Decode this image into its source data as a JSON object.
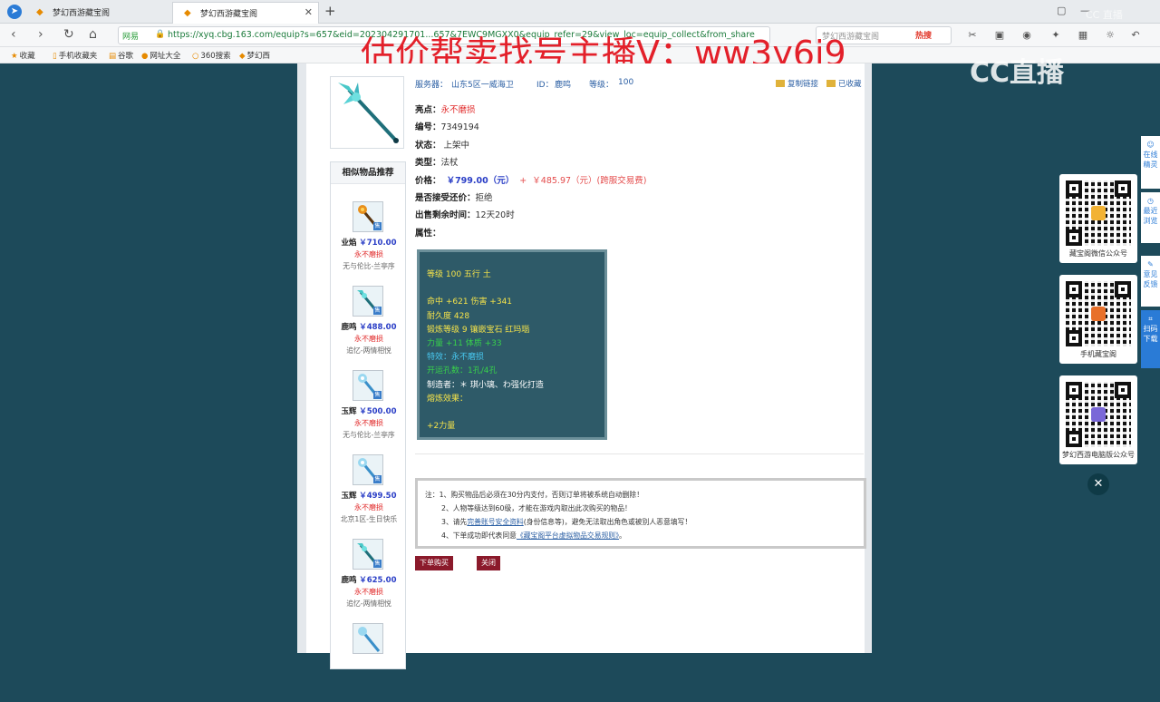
{
  "browser": {
    "tabs": [
      {
        "label": "梦幻西游藏宝阁"
      },
      {
        "label": "梦幻西游藏宝阁"
      }
    ],
    "url": "https://xyq.cbg.163.com/equip?s=657&eid=202304291701...657&7EWC9MGXX0&equip_refer=29&view_loc=equip_collect&from_share",
    "site_label": "网易",
    "search_placeholder": "梦幻西游藏宝阁",
    "hot_label": "热搜",
    "bookmarks": [
      "收藏",
      "手机收藏夹",
      "谷歌",
      "网址大全",
      "360搜索",
      "梦幻西"
    ]
  },
  "overlay": {
    "promo_text": "估价帮卖找号主播V；ww3y6j9",
    "logo_text": "CC直播"
  },
  "item": {
    "header": {
      "server_label": "服务器：",
      "server_value": "山东5区一威海卫",
      "id_label": "ID：",
      "id_value": "鹿鸣",
      "level_label": "等级：",
      "level_value": "100",
      "copy_link": "复制链接",
      "collected": "已收藏"
    },
    "highlight_label": "亮点：",
    "highlight_value": "永不磨损",
    "serial_label": "编号：",
    "serial_value": "7349194",
    "status_label": "状态：",
    "status_value": "上架中",
    "type_label": "类型：",
    "type_value": "法杖",
    "price_label": "价格：",
    "price_value": "￥799.00（元）",
    "price_plus": "+",
    "price_fee": "￥485.97（元）(跨服交易费)",
    "bargain_label": "是否接受还价：",
    "bargain_value": "拒绝",
    "time_label": "出售剩余时间：",
    "time_value": "12天20时",
    "props_label": "属性：",
    "stats": {
      "line1": "等级 100  五行 土",
      "line2": "命中 +621 伤害 +341",
      "line3": "耐久度 428",
      "line4": "锻炼等级 9  镶嵌宝石 红玛瑙",
      "line5": "力量 +11 体质 +33",
      "line6": "特效：永不磨损",
      "line7": "开运孔数：1孔/4孔",
      "line8": "制造者：＊ 琪小璃、わ强化打造",
      "line9": "熔炼效果：",
      "line10": "+2力量"
    }
  },
  "notes": {
    "line1": "注：1、购买物品后必须在30分内支付，否则订单将被系统自动删除！",
    "line2": "2、人物等级达到60级，才能在游戏内取出此次购买的物品！",
    "line3_pre": "3、请先",
    "line3_link": "完善账号安全资料",
    "line3_post": "(身份信息等)，避免无法取出角色或被别人恶意填写！",
    "line4_pre": "4、下单成功即代表同意",
    "line4_link": "《藏宝阁平台虚拟物品交易规则》",
    "line4_post": "。"
  },
  "buttons": {
    "buy": "下单购买",
    "close": "关闭"
  },
  "related": {
    "title": "相似物品推荐",
    "items": [
      {
        "name": "业焰",
        "price": "￥710.00",
        "tag": "永不磨损",
        "server": "无与伦比-兰亭序"
      },
      {
        "name": "鹿鸣",
        "price": "￥488.00",
        "tag": "永不磨损",
        "server": "追忆-两情相悦"
      },
      {
        "name": "玉辉",
        "price": "￥500.00",
        "tag": "永不磨损",
        "server": "无与伦比-兰亭序"
      },
      {
        "name": "玉辉",
        "price": "￥499.50",
        "tag": "永不磨损",
        "server": "北京1区-生日快乐"
      },
      {
        "name": "鹿鸣",
        "price": "￥625.00",
        "tag": "永不磨损",
        "server": "追忆-两情相悦"
      }
    ]
  },
  "side_qr": [
    {
      "label": "藏宝阁微信公众号"
    },
    {
      "label": "手机藏宝阁"
    },
    {
      "label": "梦幻西游电脑版公众号"
    }
  ],
  "side_tabs": [
    {
      "label": "在线\n精灵"
    },
    {
      "label": "最近\n浏览"
    },
    {
      "label": "意见\n反馈"
    },
    {
      "label": "扫码\n下载"
    }
  ]
}
